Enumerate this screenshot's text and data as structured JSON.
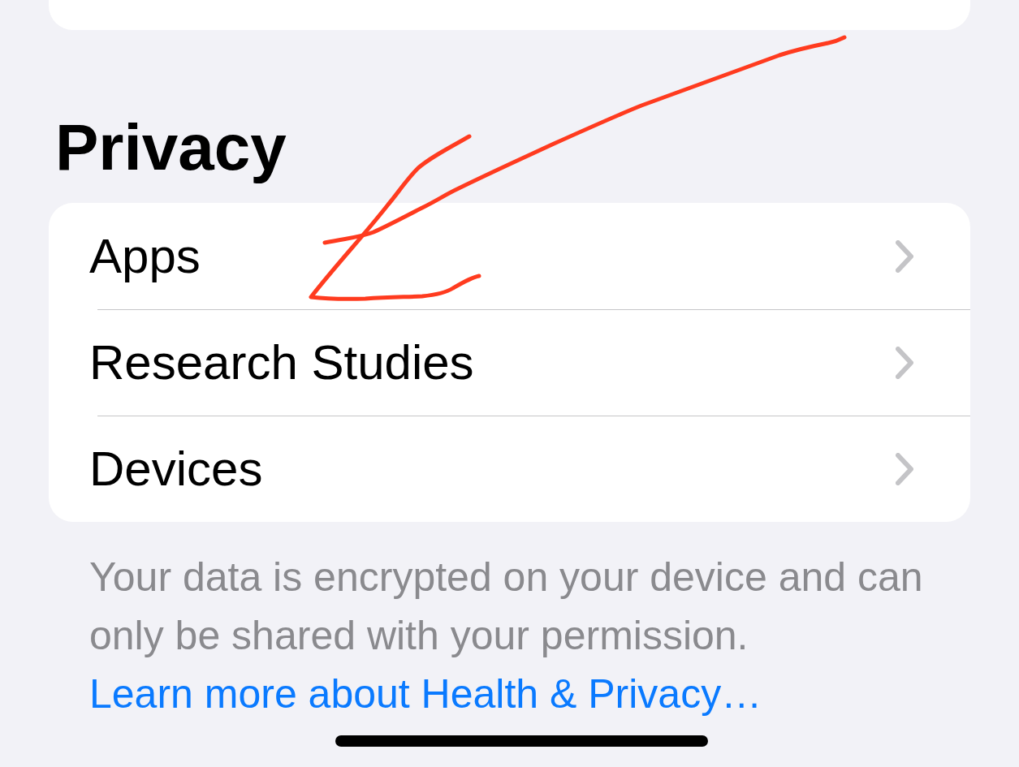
{
  "section": {
    "title": "Privacy"
  },
  "rows": [
    {
      "label": "Apps"
    },
    {
      "label": "Research Studies"
    },
    {
      "label": "Devices"
    }
  ],
  "footer": {
    "text": "Your data is encrypted on your device and can only be shared with your permission.",
    "link": "Learn more about Health & Privacy…"
  }
}
